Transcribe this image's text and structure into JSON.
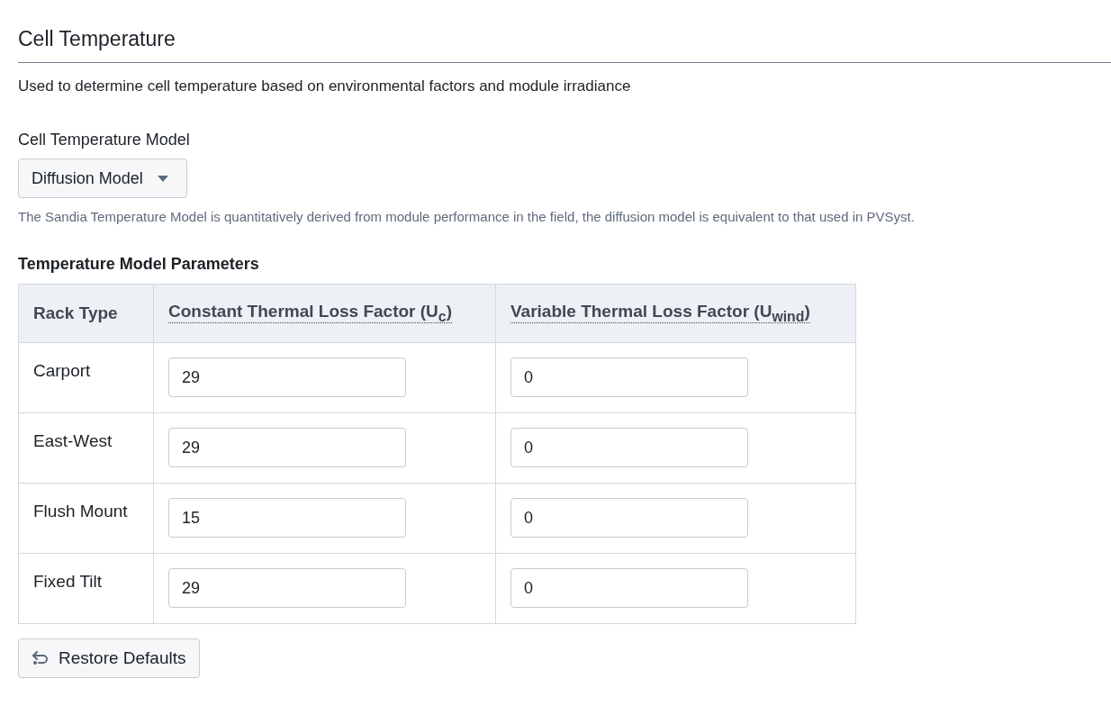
{
  "section": {
    "title": "Cell Temperature",
    "description": "Used to determine cell temperature based on environmental factors and module irradiance"
  },
  "model": {
    "label": "Cell Temperature Model",
    "value": "Diffusion Model",
    "help": "The Sandia Temperature Model is quantitatively derived from module performance in the field, the diffusion model is equivalent to that used in PVSyst."
  },
  "parameters": {
    "title": "Temperature Model Parameters",
    "columns": [
      "Rack Type",
      "Constant Thermal Loss Factor (U$_{c}$)",
      "Variable Thermal Loss Factor (U$_{wind}$)"
    ],
    "rows": [
      {
        "rack_type": "Carport",
        "constant": "29",
        "variable": "0"
      },
      {
        "rack_type": "East-West",
        "constant": "29",
        "variable": "0"
      },
      {
        "rack_type": "Flush Mount",
        "constant": "15",
        "variable": "0"
      },
      {
        "rack_type": "Fixed Tilt",
        "constant": "29",
        "variable": "0"
      }
    ]
  },
  "restore_button": "Restore Defaults"
}
